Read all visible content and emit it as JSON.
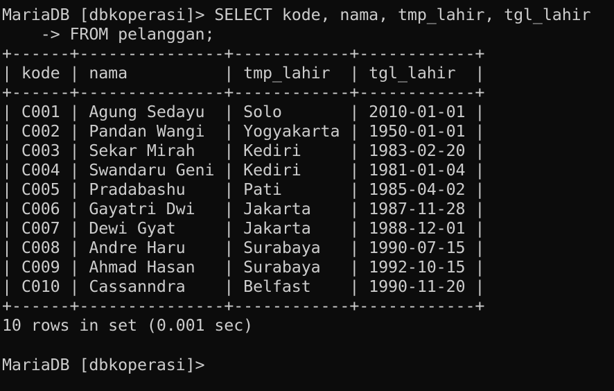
{
  "terminal": {
    "command_line_1": "MariaDB [dbkoperasi]> SELECT kode, nama, tmp_lahir, tgl_lahir",
    "command_line_2": "    -> FROM pelanggan;",
    "table_border": "+------+---------------+------------+------------+",
    "header_row": "| kode | nama          | tmp_lahir  | tgl_lahir  |",
    "rows": [
      "| C001 | Agung Sedayu  | Solo       | 2010-01-01 |",
      "| C002 | Pandan Wangi  | Yogyakarta | 1950-01-01 |",
      "| C003 | Sekar Mirah   | Kediri     | 1983-02-20 |",
      "| C004 | Swandaru Geni | Kediri     | 1981-01-04 |",
      "| C005 | Pradabashu    | Pati       | 1985-04-02 |",
      "| C006 | Gayatri Dwi   | Jakarta    | 1987-11-28 |",
      "| C007 | Dewi Gyat     | Jakarta    | 1988-12-01 |",
      "| C008 | Andre Haru    | Surabaya   | 1990-07-15 |",
      "| C009 | Ahmad Hasan   | Surabaya   | 1992-10-15 |",
      "| C010 | Cassanndra    | Belfast    | 1990-11-20 |"
    ],
    "result_summary": "10 rows in set (0.001 sec)",
    "prompt": "MariaDB [dbkoperasi]>",
    "colors": {
      "background": "#0c0c0c",
      "text": "#cccccc"
    }
  }
}
